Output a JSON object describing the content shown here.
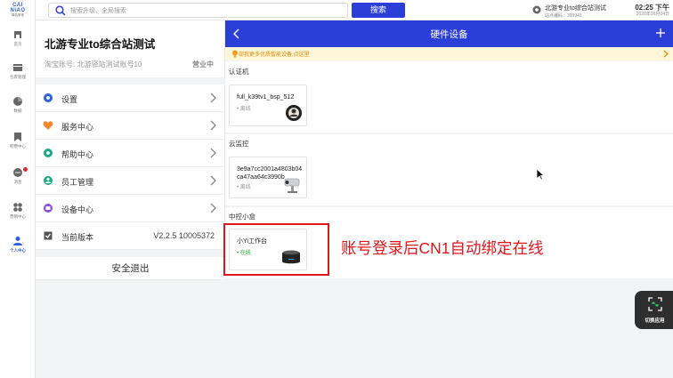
{
  "brand": {
    "line1": "CAI",
    "line2": "NIAO",
    "line3": "驿站掌柜"
  },
  "rail": [
    {
      "label": "首页",
      "icon": "home-icon"
    },
    {
      "label": "包裹管理",
      "icon": "package-icon"
    },
    {
      "label": "数据",
      "icon": "pie-chart-icon"
    },
    {
      "label": "积攒中心",
      "icon": "bookmark-icon"
    },
    {
      "label": "消息",
      "icon": "message-icon"
    },
    {
      "label": "营销中心",
      "icon": "apps-icon"
    },
    {
      "label": "个人中心",
      "icon": "person-icon"
    }
  ],
  "topbar": {
    "search_placeholder": "搜索升级、全局搜索",
    "search_button": "搜索",
    "station_name": "北游专业to综合站测试",
    "station_code": "站点编码：399941",
    "time": "02:25 下午",
    "date": "2020年09月04日"
  },
  "account": {
    "title": "北游专业to综合站测试",
    "subtitle": "淘宝账号: 北游驿站测试账号10",
    "status": "营业中",
    "menu": [
      {
        "label": "设置",
        "icon": "gear-icon",
        "color": "#2b5fe0"
      },
      {
        "label": "服务中心",
        "icon": "heart-icon",
        "color": "#f08a2c"
      },
      {
        "label": "帮助中心",
        "icon": "help-icon",
        "color": "#1aaa8a"
      },
      {
        "label": "员工管理",
        "icon": "staff-icon",
        "color": "#1aaa8a"
      },
      {
        "label": "设备中心",
        "icon": "device-icon",
        "color": "#8a4fd8"
      }
    ],
    "version_label": "当前版本",
    "version_value": "V2.2.5 10005372",
    "logout": "安全退出"
  },
  "hardware": {
    "title": "硬件设备",
    "notice": "部我更多优质智能设备,点这里",
    "sections": [
      {
        "label": "认证机",
        "devices": [
          {
            "name": "full_k39tv1_bsp_512",
            "status": "• 离线"
          }
        ]
      },
      {
        "label": "云监控",
        "devices": [
          {
            "name": "3e9a7cc2001a4803b04",
            "name2": "ca47aa64c3990b",
            "status": "• 离线"
          }
        ]
      },
      {
        "label": "中控小盒",
        "devices": [
          {
            "name": "小Yi工作台",
            "status": "• 在线"
          }
        ]
      }
    ]
  },
  "annotation": "账号登录后CN1自动绑定在线",
  "switch_app": "切换应用",
  "colors": {
    "primary": "#2b3fd8",
    "online": "#1aaa3a",
    "annotation": "#e0161d"
  }
}
